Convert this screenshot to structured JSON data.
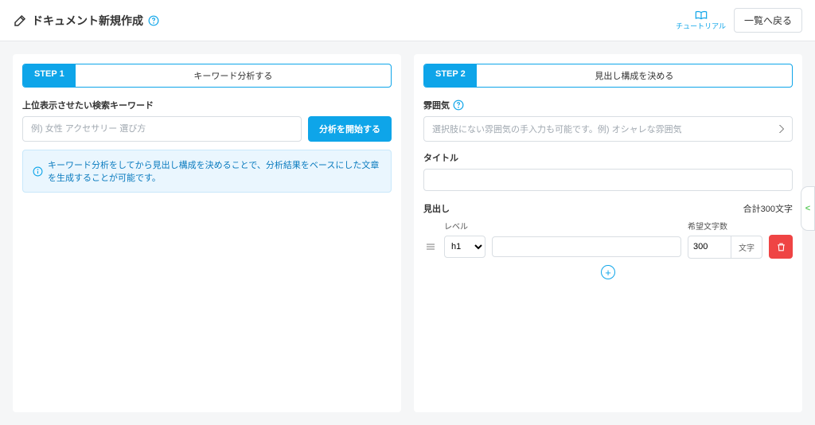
{
  "header": {
    "title": "ドキュメント新規作成",
    "tutorial_label": "チュートリアル",
    "back_label": "一覧へ戻る"
  },
  "step1": {
    "tag": "STEP 1",
    "title": "キーワード分析する",
    "keyword_label": "上位表示させたい検索キーワード",
    "keyword_placeholder": "例) 女性 アクセサリー 選び方",
    "analyze_button": "分析を開始する",
    "info_text": "キーワード分析をしてから見出し構成を決めることで、分析結果をベースにした文章を生成することが可能です。"
  },
  "step2": {
    "tag": "STEP 2",
    "title": "見出し構成を決める",
    "atmosphere_label": "雰囲気",
    "atmosphere_placeholder": "選択肢にない雰囲気の手入力も可能です。例) オシャレな雰囲気",
    "title_label": "タイトル",
    "heading_label": "見出し",
    "char_count_label": "合計300文字",
    "columns": {
      "level": "レベル",
      "chars": "希望文字数"
    },
    "heading_row": {
      "level_value": "h1",
      "chars_value": "300",
      "chars_suffix": "文字"
    }
  }
}
